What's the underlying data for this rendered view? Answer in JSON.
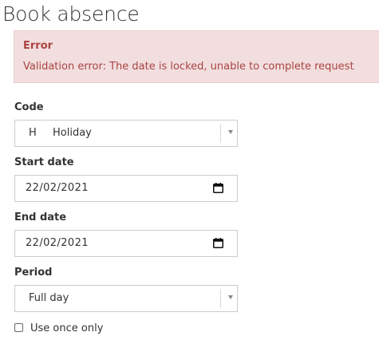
{
  "page": {
    "title": "Book absence"
  },
  "error": {
    "title": "Error",
    "message": "Validation error: The date is locked, unable to complete request"
  },
  "form": {
    "code": {
      "label": "Code",
      "selected_code": "H",
      "selected_text": "Holiday"
    },
    "start_date": {
      "label": "Start date",
      "value": "22/02/2021"
    },
    "end_date": {
      "label": "End date",
      "value": "22/02/2021"
    },
    "period": {
      "label": "Period",
      "selected_text": "Full day"
    },
    "use_once": {
      "label": "Use once only",
      "checked": false
    }
  },
  "colors": {
    "error_bg": "#f2dede",
    "error_border": "#ebccd1",
    "error_text": "#a94442",
    "field_border": "#cccccc"
  },
  "icons": {
    "dropdown": "chevron-down-icon",
    "date_picker": "calendar-icon"
  }
}
